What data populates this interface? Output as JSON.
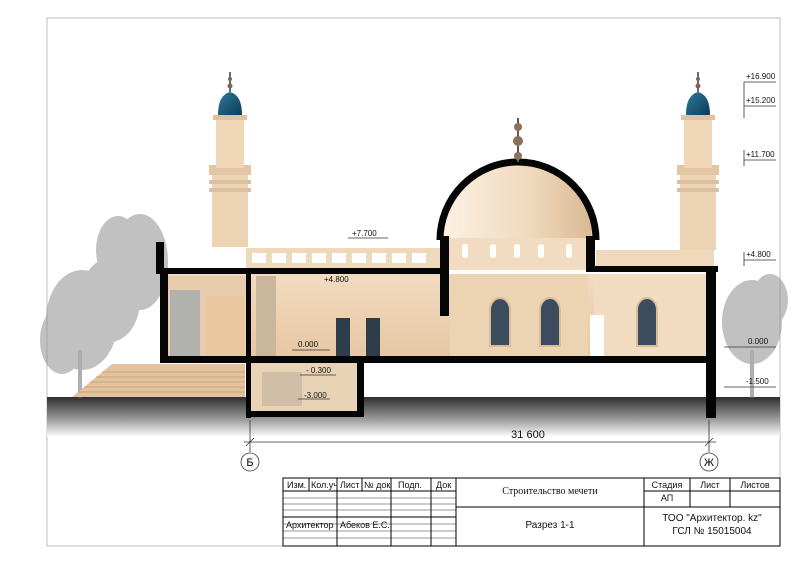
{
  "elevation_marks": {
    "top_right": [
      "+16.900",
      "+15.200",
      "+11.700",
      "+4.800"
    ],
    "right_ground": "0.000",
    "right_low": "-1.500",
    "roof": "+7.700",
    "interior_floor": "+4.800",
    "ground_floor": "0.000",
    "basement_floor": "- 0.300",
    "basement_bottom": "-3.000"
  },
  "dimension": {
    "overall": "31 600"
  },
  "axes": {
    "left": "Б",
    "right": "Ж"
  },
  "title_block": {
    "headers": [
      "Изм.",
      "Кол.уч",
      "Лист",
      "№ док",
      "Подп.",
      "Док"
    ],
    "role": "Архитектор",
    "name": "Абеков Е.С.",
    "project": "Строительство мечети",
    "sheet_title": "Разрез 1-1",
    "stage_label": "Стадия",
    "sheet_label": "Лист",
    "sheets_label": "Листов",
    "stage_value": "АП",
    "company_line1": "ТОО \"Архитектор. kz\"",
    "company_line2": "ГСЛ № 15015004"
  }
}
